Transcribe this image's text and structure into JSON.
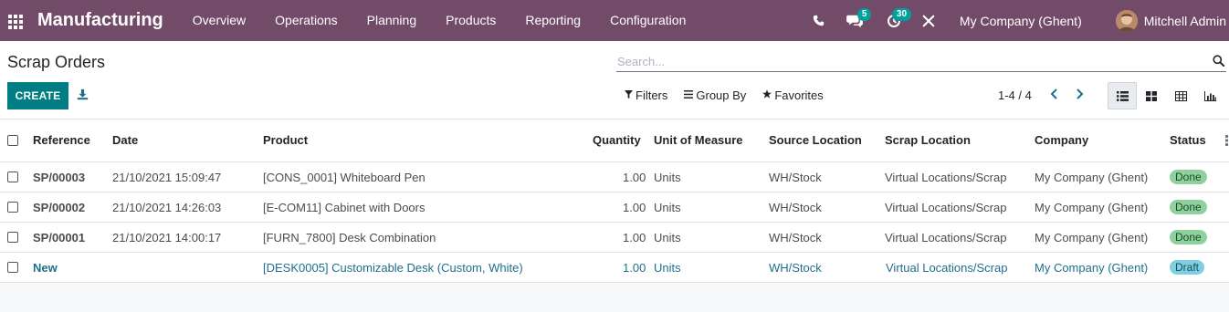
{
  "app": {
    "name": "Manufacturing",
    "menu": [
      "Overview",
      "Operations",
      "Planning",
      "Products",
      "Reporting",
      "Configuration"
    ],
    "messages_count": "5",
    "activities_count": "30",
    "company": "My Company (Ghent)",
    "user": "Mitchell Admin"
  },
  "page": {
    "title": "Scrap Orders",
    "search_placeholder": "Search...",
    "create_label": "CREATE",
    "filters_label": "Filters",
    "group_by_label": "Group By",
    "favorites_label": "Favorites",
    "pager": "1-4 / 4"
  },
  "table": {
    "columns": [
      "Reference",
      "Date",
      "Product",
      "Quantity",
      "Unit of Measure",
      "Source Location",
      "Scrap Location",
      "Company",
      "Status"
    ],
    "rows": [
      {
        "reference": "SP/00003",
        "date": "21/10/2021 15:09:47",
        "product": "[CONS_0001] Whiteboard Pen",
        "quantity": "1.00",
        "uom": "Units",
        "source": "WH/Stock",
        "scrap": "Virtual Locations/Scrap",
        "company": "My Company (Ghent)",
        "status": "Done"
      },
      {
        "reference": "SP/00002",
        "date": "21/10/2021 14:26:03",
        "product": "[E-COM11] Cabinet with Doors",
        "quantity": "1.00",
        "uom": "Units",
        "source": "WH/Stock",
        "scrap": "Virtual Locations/Scrap",
        "company": "My Company (Ghent)",
        "status": "Done"
      },
      {
        "reference": "SP/00001",
        "date": "21/10/2021 14:00:17",
        "product": "[FURN_7800] Desk Combination",
        "quantity": "1.00",
        "uom": "Units",
        "source": "WH/Stock",
        "scrap": "Virtual Locations/Scrap",
        "company": "My Company (Ghent)",
        "status": "Done"
      },
      {
        "reference": "New",
        "date": "",
        "product": "[DESK0005] Customizable Desk (Custom, White)",
        "quantity": "1.00",
        "uom": "Units",
        "source": "WH/Stock",
        "scrap": "Virtual Locations/Scrap",
        "company": "My Company (Ghent)",
        "status": "Draft"
      }
    ]
  },
  "colors": {
    "navbar": "#714b67",
    "primary": "#017e84",
    "badge": "#00a09d",
    "done": "#8fd19e",
    "draft": "#7fcfe0"
  }
}
